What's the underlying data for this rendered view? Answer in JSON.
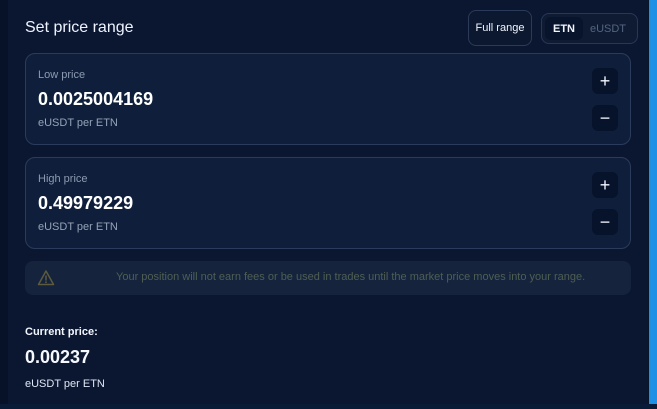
{
  "header": {
    "title": "Set price range",
    "full_range_label": "Full range",
    "tokens": [
      "ETN",
      "eUSDT"
    ],
    "selected_token": "ETN"
  },
  "low_price": {
    "label": "Low price",
    "value": "0.0025004169",
    "unit": "eUSDT per ETN",
    "plus_symbol": "+",
    "minus_symbol": "−"
  },
  "high_price": {
    "label": "High price",
    "value": "0.49979229",
    "unit": "eUSDT per ETN",
    "plus_symbol": "+",
    "minus_symbol": "−"
  },
  "warning": {
    "text": "Your position will not earn fees or be used in trades until the market price moves into your range.",
    "icon": "warning-triangle-icon"
  },
  "current": {
    "label": "Current price:",
    "value": "0.00237",
    "unit": "eUSDT per ETN"
  },
  "colors": {
    "background": "#0b1730",
    "card": "#0f1f3b",
    "accent": "#1e90e6",
    "warning_text": "#4f5f53"
  }
}
